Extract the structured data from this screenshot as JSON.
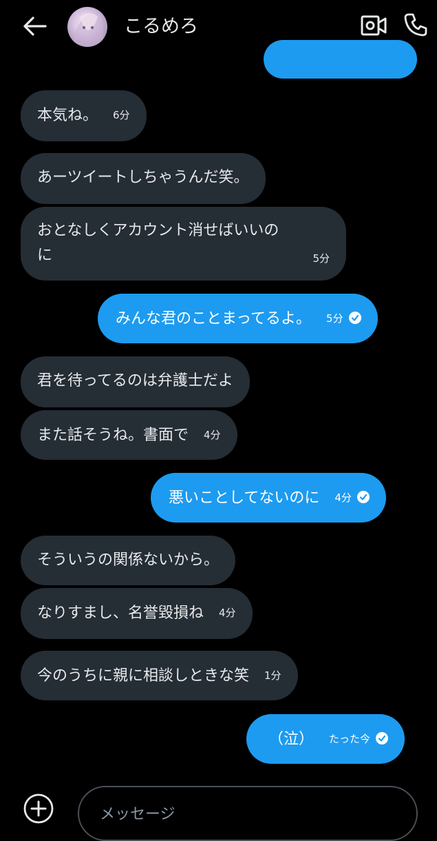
{
  "header": {
    "title": "こるめろ"
  },
  "colors": {
    "background": "#000000",
    "received_bubble": "#252d35",
    "sent_bubble": "#1d9bf0",
    "text": "#e7e9ea"
  },
  "messages": [
    {
      "side": "sent",
      "text": "",
      "time": ""
    },
    {
      "side": "received",
      "text": "本気ね。",
      "time": "6分"
    },
    {
      "side": "received",
      "text": "あーツイートしちゃうんだ笑。",
      "time": ""
    },
    {
      "side": "received",
      "text_line1": "おとなしくアカウント消せばいいの",
      "text_line2": "に",
      "time": "5分"
    },
    {
      "side": "sent",
      "text": "みんな君のことまってるよ。",
      "time": "5分",
      "read": true
    },
    {
      "side": "received",
      "text": "君を待ってるのは弁護士だよ",
      "time": ""
    },
    {
      "side": "received",
      "text": "また話そうね。書面で",
      "time": "4分"
    },
    {
      "side": "sent",
      "text": "悪いことしてないのに",
      "time": "4分",
      "read": true
    },
    {
      "side": "received",
      "text": "そういうの関係ないから。",
      "time": ""
    },
    {
      "side": "received",
      "text": "なりすまし、名誉毀損ね",
      "time": "4分"
    },
    {
      "side": "received",
      "text": "今のうちに親に相談しときな笑",
      "time": "1分"
    },
    {
      "side": "sent",
      "text": "（泣）",
      "time": "たった今",
      "read": true
    }
  ],
  "composer": {
    "placeholder": "メッセージ"
  },
  "icons": {
    "back": "back-arrow-icon",
    "video": "video-call-icon",
    "phone": "phone-call-icon",
    "add": "add-circle-icon",
    "read": "read-check-icon"
  }
}
